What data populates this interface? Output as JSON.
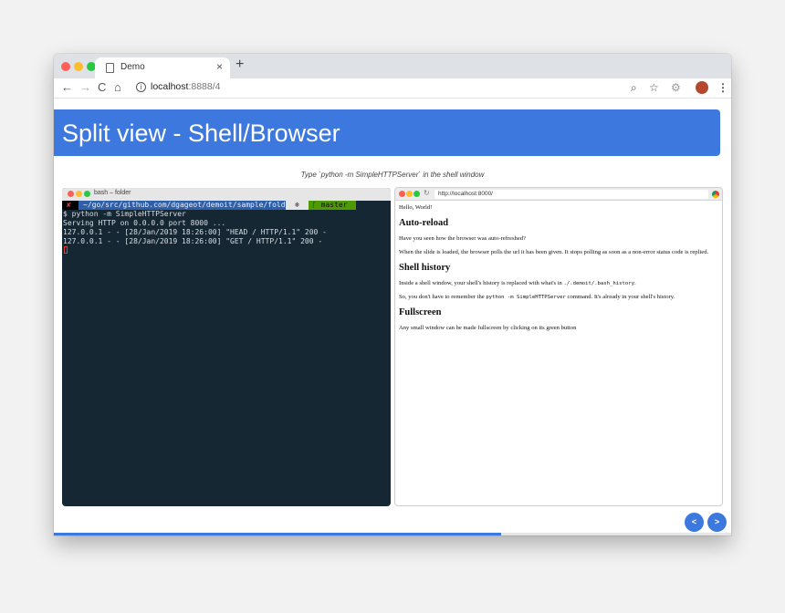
{
  "window": {
    "tab_title": "Demo",
    "tab_close": "×",
    "new_tab": "+",
    "url_host": "localhost",
    "url_rest": ":8888/4",
    "nav": {
      "back": "←",
      "forward": "→",
      "reload": "C",
      "home": "⌂"
    },
    "info_icon": "i",
    "toolbar_icons": [
      "zoom-icon",
      "star-icon",
      "extension-icon",
      "avatar",
      "menu-icon"
    ]
  },
  "slide": {
    "title": "Split view - Shell/Browser",
    "subtitle": "Type `python -m SimpleHTTPServer` in the shell window",
    "progress_percent": 66,
    "prev_label": "<",
    "next_label": ">"
  },
  "terminal": {
    "title": "bash – folder",
    "prompt": {
      "status": "✘",
      "path": "~/go/src/github.com/dgageot/demoit/sample/folder",
      "git_branch": "master"
    },
    "lines": [
      "$ python -m SimpleHTTPServer",
      "Serving HTTP on 0.0.0.0 port 8000 ...",
      "127.0.0.1 - - [28/Jan/2019 18:26:00] \"HEAD / HTTP/1.1\" 200 -",
      "127.0.0.1 - - [28/Jan/2019 18:26:00] \"GET / HTTP/1.1\" 200 -"
    ]
  },
  "browser_pane": {
    "url": "http://localhost:8000/",
    "hello": "Hello, World!",
    "h_autoreload": "Auto-reload",
    "p_autoreload_1": "Have you seen how the browser was auto-refreshed?",
    "p_autoreload_2": "When the slide is loaded, the browser polls the url it has been given. It stops polling as soon as a non-error status code is replied.",
    "h_history": "Shell history",
    "p_history_1a": "Inside a shell window, your shell's history is replaced with what's in ",
    "p_history_1b": "./.demoit/.bash_history",
    "p_history_1c": ".",
    "p_history_2a": "So, you don't have to remember the ",
    "p_history_2b": "python -m SimpleHTTPServer",
    "p_history_2c": " command. It's already in your shell's history.",
    "h_fullscreen": "Fullscreen",
    "p_fullscreen": "Any small window can be made fullscreen by clicking on its green button"
  },
  "colors": {
    "accent": "#3d78de",
    "terminal_bg": "#162734",
    "traffic_red": "#fe5f57",
    "traffic_yellow": "#febc2e",
    "traffic_green": "#28c840",
    "prompt_path_bg": "#2f5fa8",
    "prompt_git_bg": "#4e9a06"
  }
}
